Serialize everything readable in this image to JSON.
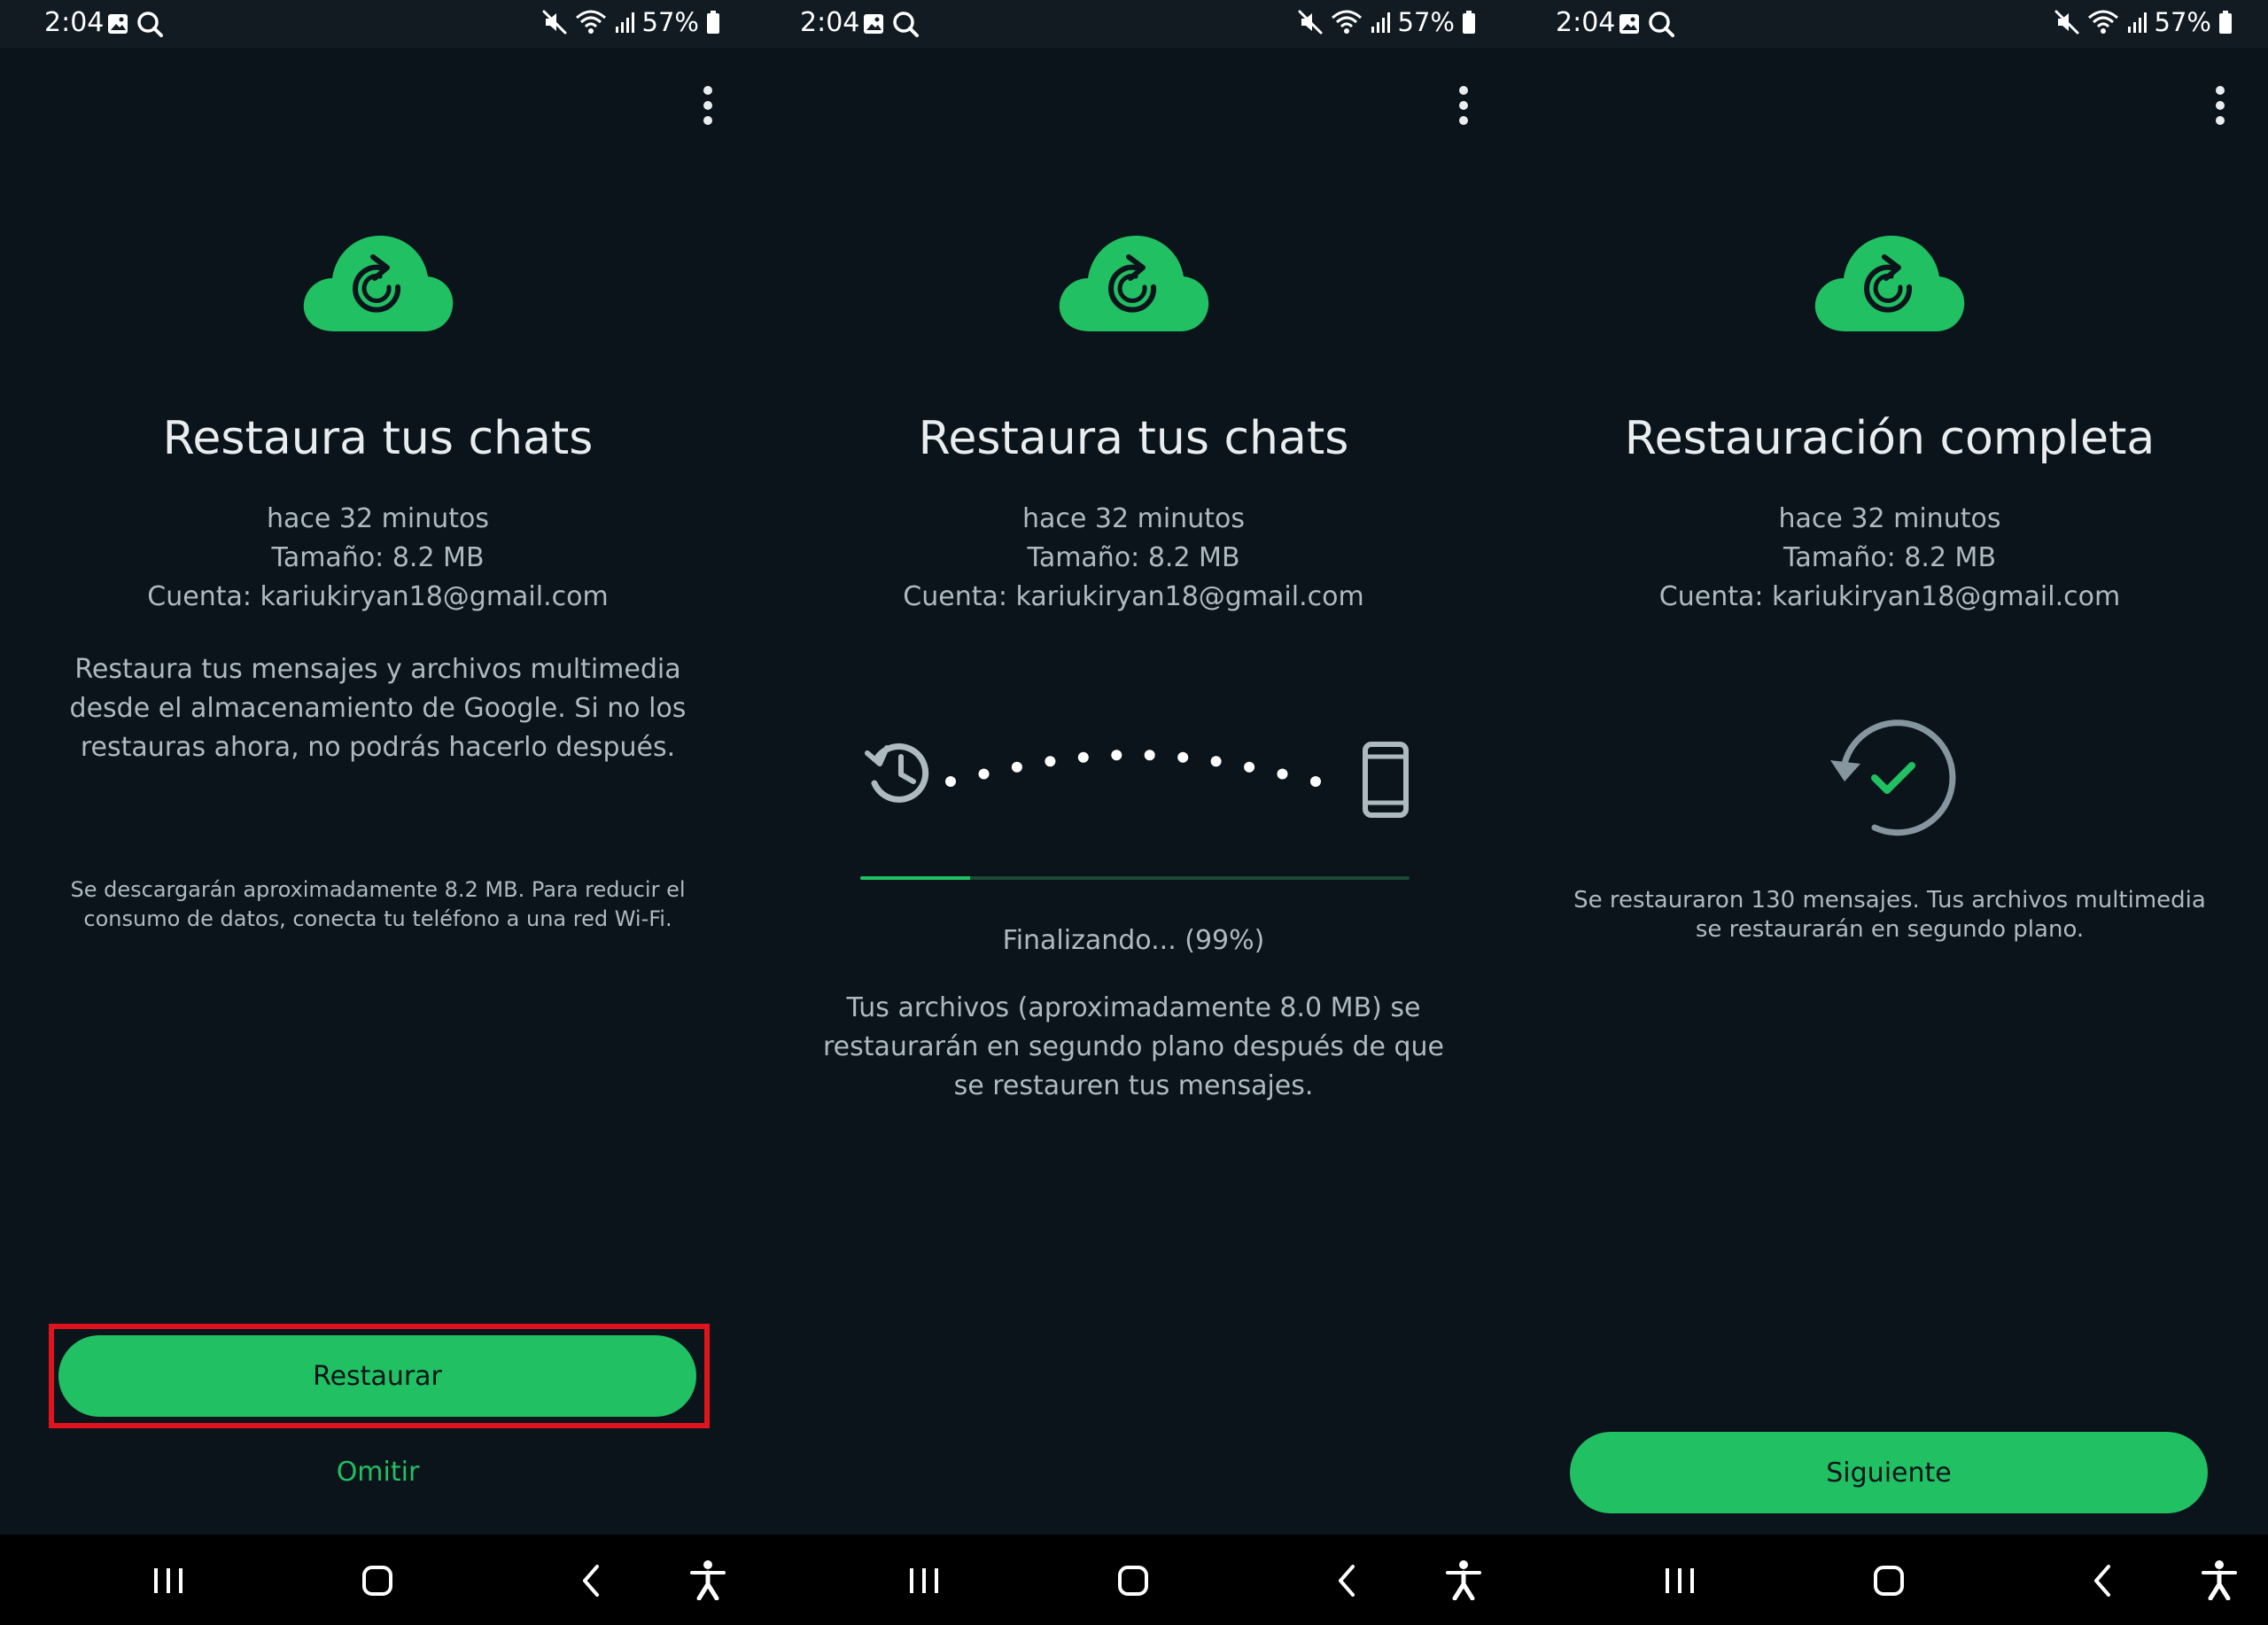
{
  "status_bar": {
    "time": "2:04",
    "battery": "57%",
    "icons": [
      "gallery-icon",
      "search-notification-icon",
      "mute-icon",
      "wifi-icon",
      "signal-icon",
      "battery-icon"
    ]
  },
  "colors": {
    "background": "#0b141a",
    "accent": "#21c063",
    "text_primary": "#e9edef",
    "text_secondary": "#aebac1",
    "highlight_border": "#e0141e"
  },
  "screens": [
    {
      "title": "Restaura tus chats",
      "backup_time": "hace 32 minutos",
      "size": "Tamaño: 8.2 MB",
      "account": "Cuenta: kariukiryan18@gmail.com",
      "description": "Restaura tus mensajes y archivos multimedia desde el almacenamiento de Google. Si no los restauras ahora, no podrás hacerlo después.",
      "data_note": "Se descargarán aproximadamente 8.2 MB. Para reducir el consumo de datos, conecta tu teléfono a una red Wi-Fi.",
      "primary_button": "Restaurar",
      "secondary_link": "Omitir"
    },
    {
      "title": "Restaura tus chats",
      "backup_time": "hace 32 minutos",
      "size": "Tamaño: 8.2 MB",
      "account": "Cuenta: kariukiryan18@gmail.com",
      "progress_percent": 20,
      "progress_text": "Finalizando... (99%)",
      "description": "Tus archivos (aproximadamente 8.0 MB) se restaurarán en segundo plano después de que se restauren tus mensajes."
    },
    {
      "title": "Restauración completa",
      "backup_time": "hace 32 minutos",
      "size": "Tamaño: 8.2 MB",
      "account": "Cuenta: kariukiryan18@gmail.com",
      "result": "Se restauraron 130 mensajes. Tus archivos multimedia se restaurarán en segundo plano.",
      "primary_button": "Siguiente"
    }
  ]
}
